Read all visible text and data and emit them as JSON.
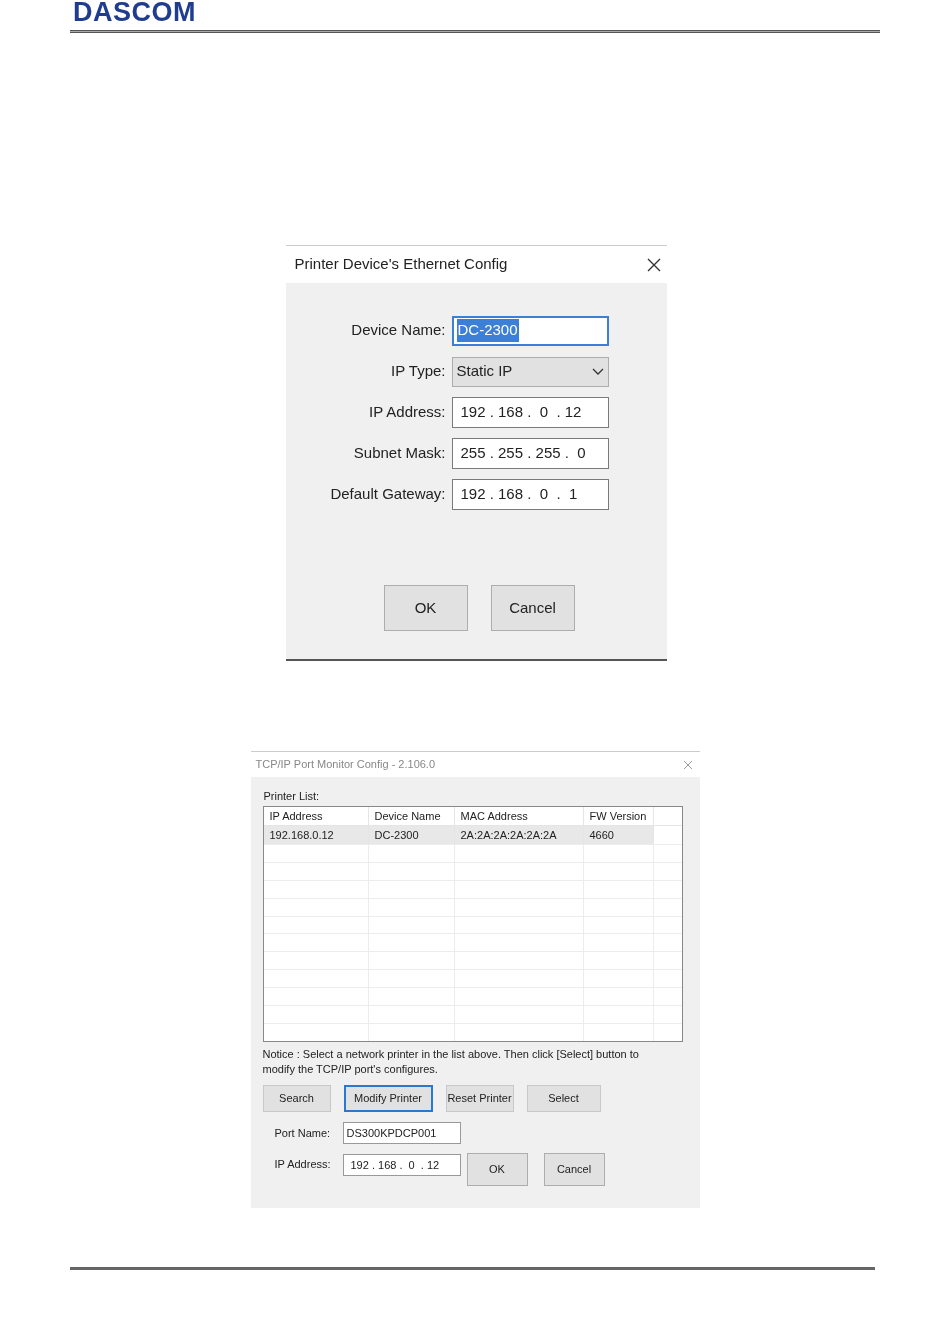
{
  "header": {
    "logo": "DASCOM"
  },
  "ethernet_dialog": {
    "title": "Printer Device's Ethernet Config",
    "fields": [
      {
        "kind": "text",
        "label": "Device Name:",
        "value": "DC-2300",
        "selected": true
      },
      {
        "kind": "dropdown",
        "label": "IP Type:",
        "value": "Static IP"
      },
      {
        "kind": "ip",
        "label": "IP Address:",
        "value": "192 . 168 .  0  . 12"
      },
      {
        "kind": "ip",
        "label": "Subnet Mask:",
        "value": "255 . 255 . 255 .  0"
      },
      {
        "kind": "ip",
        "label": "Default Gateway:",
        "value": "192 . 168 .  0  .  1"
      }
    ],
    "buttons": [
      "OK",
      "Cancel"
    ]
  },
  "port_dialog": {
    "title": "TCP/IP Port Monitor Config - 2.106.0",
    "list_label": "Printer List:",
    "table": {
      "columns": [
        "IP Address",
        "Device Name",
        "MAC Address",
        "FW Version"
      ],
      "rows": [
        {
          "cells": [
            "192.168.0.12",
            "DC-2300",
            "2A:2A:2A:2A:2A:2A",
            "4660"
          ],
          "selected": true
        }
      ]
    },
    "notice": "Notice : Select a network printer in the list above. Then click [Select] button to modify the TCP/IP port's configures.",
    "actions": [
      {
        "label": "Search",
        "focused": false
      },
      {
        "label": "Modify Printer",
        "focused": true
      },
      {
        "label": "Reset Printer",
        "focused": false
      },
      {
        "label": "Select",
        "focused": false
      }
    ],
    "port_name": {
      "label": "Port Name:",
      "value": "DS300KPDCP001"
    },
    "ip_address": {
      "label": "IP Address:",
      "value": "192 . 168 .  0  . 12"
    },
    "buttons": [
      "OK",
      "Cancel"
    ]
  }
}
